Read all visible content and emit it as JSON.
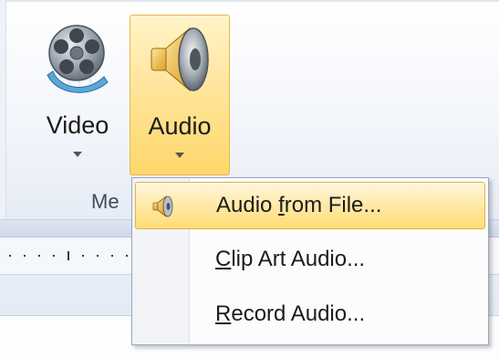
{
  "ribbon": {
    "video_button": {
      "label": "Video",
      "icon": "film-reel-icon"
    },
    "audio_button": {
      "label": "Audio",
      "icon": "speaker-icon"
    },
    "group_label": "Me"
  },
  "audio_menu": {
    "items": [
      {
        "label_pre": "Audio ",
        "label_key": "f",
        "label_post": "rom File...",
        "icon": "speaker-icon"
      },
      {
        "label_pre": "",
        "label_key": "C",
        "label_post": "lip Art Audio...",
        "icon": ""
      },
      {
        "label_pre": "",
        "label_key": "R",
        "label_post": "ecord Audio...",
        "icon": ""
      }
    ]
  },
  "colors": {
    "highlight": "#ffe59c",
    "highlight_border": "#e6b84c",
    "ribbon_bg": "#f3f6fb"
  }
}
